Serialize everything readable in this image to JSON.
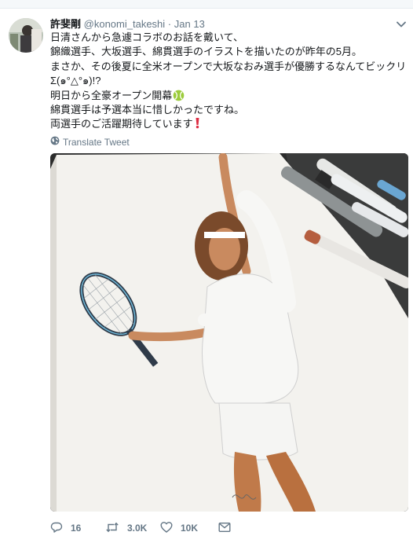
{
  "author": {
    "display_name": "許斐剛",
    "handle": "@konomi_takeshi",
    "separator": "·",
    "date": "Jan 13"
  },
  "tweet": {
    "lines": [
      "日清さんから急遽コラボのお話を戴いて、",
      "錦織選手、大坂選手、綿貫選手のイラストを描いたのが昨年の5月。",
      "まさか、その後夏に全米オープンで大坂なおみ選手が優勝するなんてビックリ",
      "Σ(๑°△°๑)!?",
      "明日から全豪オープン開幕",
      "綿貫選手は予選本当に惜しかったですね。",
      "両選手のご活躍期待しています"
    ]
  },
  "translate_label": "Translate Tweet",
  "actions": {
    "reply_count": "16",
    "retweet_count": "3.0K",
    "like_count": "10K"
  },
  "icons": {
    "caret": "chevron-down-icon",
    "globe": "globe-icon",
    "reply": "reply-icon",
    "retweet": "retweet-icon",
    "like": "heart-icon",
    "dm": "envelope-icon",
    "tennis": "tennis-ball-emoji",
    "exclamation": "red-exclamation-emoji"
  },
  "colors": {
    "text": "#14171a",
    "secondary": "#657786",
    "accent": "#1da1f2",
    "emoji_tennis": "#9ccc3c",
    "emoji_exclamation": "#dd2e44"
  }
}
